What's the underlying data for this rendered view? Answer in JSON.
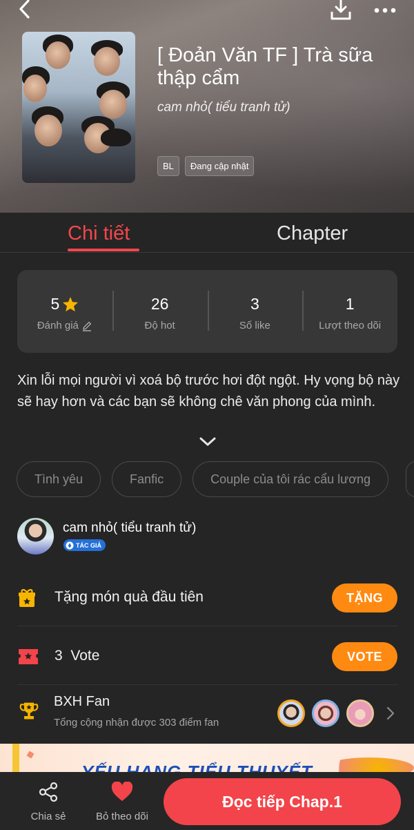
{
  "header": {
    "title": "[ Đoản Văn TF ] Trà sữa thập cẩm",
    "author": "cam nhỏ( tiểu tranh tử)",
    "tags": [
      "BL",
      "Đang cập nhật"
    ]
  },
  "tabs": {
    "detail": "Chi tiết",
    "chapter": "Chapter"
  },
  "stats": [
    {
      "value": "5",
      "label": "Đánh giá"
    },
    {
      "value": "26",
      "label": "Độ hot"
    },
    {
      "value": "3",
      "label": "Số like"
    },
    {
      "value": "1",
      "label": "Lượt theo dõi"
    }
  ],
  "description": "Xin lỗi mọi người vì xoá bộ trước hơi đột ngột. Hy vọng bộ này sẽ hay hơn và các bạn sẽ không chê văn phong của mình.",
  "genres": [
    "Tình yêu",
    "Fanfic",
    "Couple của tôi rác cẩu lương"
  ],
  "author_block": {
    "name": "cam nhỏ( tiểu tranh tử)",
    "badge": "TÁC GIẢ"
  },
  "gift": {
    "label": "Tặng món quà đầu tiên",
    "button": "TẶNG"
  },
  "vote": {
    "count": "3",
    "label": "Vote",
    "button": "VOTE"
  },
  "fan": {
    "title": "BXH Fan",
    "subtitle": "Tổng cộng nhận được 303 điểm fan"
  },
  "banner": {
    "text": "YẾU HANG TIỂU THUYẾT"
  },
  "bottom": {
    "share": "Chia sẻ",
    "unfollow": "Bỏ theo dõi",
    "read": "Đọc tiếp Chap.1"
  },
  "colors": {
    "accent": "#f2474b",
    "orange": "#ff8a12",
    "star": "#f7b500"
  }
}
